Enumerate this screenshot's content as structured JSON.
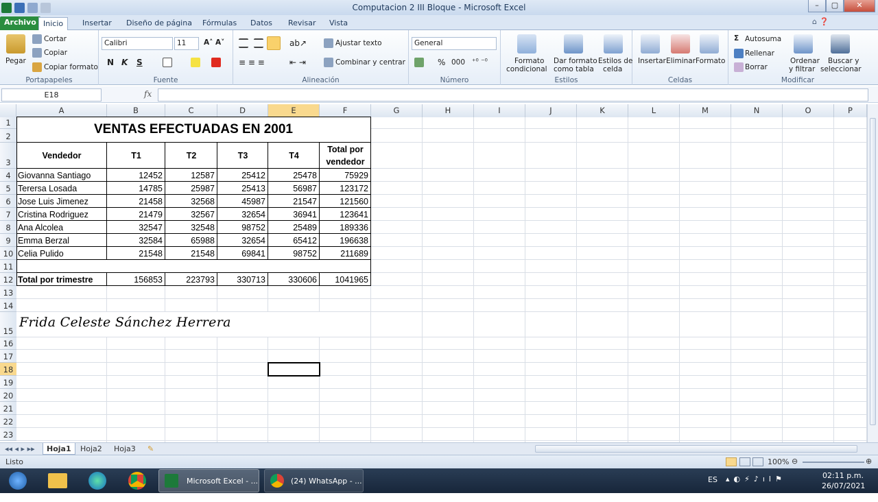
{
  "window": {
    "title": "Computacion 2 III Bloque  -  Microsoft Excel"
  },
  "tabs": [
    "Archivo",
    "Inicio",
    "Insertar",
    "Diseño de página",
    "Fórmulas",
    "Datos",
    "Revisar",
    "Vista"
  ],
  "ribbon": {
    "portapapeles": {
      "pegar": "Pegar",
      "cortar": "Cortar",
      "copiar": "Copiar",
      "copiar_formato": "Copiar formato",
      "name": "Portapapeles"
    },
    "fuente": {
      "font": "Calibri",
      "size": "11",
      "name": "Fuente",
      "bold": "N",
      "italic": "K",
      "underline": "S"
    },
    "alineacion": {
      "ajustar": "Ajustar texto",
      "combinar": "Combinar y centrar",
      "name": "Alineación"
    },
    "numero": {
      "format": "General",
      "name": "Número",
      "percent": "%",
      "thousands": "000"
    },
    "estilos": {
      "formato_cond_1": "Formato",
      "formato_cond_2": "condicional",
      "dar_formato_1": "Dar formato",
      "dar_formato_2": "como tabla",
      "estilos_celda_1": "Estilos de",
      "estilos_celda_2": "celda",
      "name": "Estilos"
    },
    "celdas": {
      "insertar": "Insertar",
      "eliminar": "Eliminar",
      "formato": "Formato",
      "name": "Celdas"
    },
    "modificar": {
      "autosuma": "Autosuma",
      "rellenar": "Rellenar",
      "borrar": "Borrar",
      "ordenar_1": "Ordenar",
      "ordenar_2": "y filtrar",
      "buscar_1": "Buscar y",
      "buscar_2": "seleccionar",
      "name": "Modificar"
    }
  },
  "formula_bar": {
    "namebox": "E18",
    "fx": "fx",
    "value": ""
  },
  "columns": [
    "A",
    "B",
    "C",
    "D",
    "E",
    "F",
    "G",
    "H",
    "I",
    "J",
    "K",
    "L",
    "M",
    "N",
    "O",
    "P"
  ],
  "rows": [
    "1",
    "2",
    "3",
    "4",
    "5",
    "6",
    "7",
    "8",
    "9",
    "10",
    "11",
    "12",
    "13",
    "14",
    "15",
    "16",
    "17",
    "18",
    "19",
    "20",
    "21",
    "22",
    "23"
  ],
  "sheet": {
    "title": "VENTAS EFECTUADAS EN 2001",
    "headers": [
      "Vendedor",
      "T1",
      "T2",
      "T3",
      "T4",
      "Total por",
      "vendedor"
    ],
    "data": [
      [
        "Giovanna Santiago",
        "12452",
        "12587",
        "25412",
        "25478",
        "75929"
      ],
      [
        "Terersa Losada",
        "14785",
        "25987",
        "25413",
        "56987",
        "123172"
      ],
      [
        "Jose Luis Jimenez",
        "21458",
        "32568",
        "45987",
        "21547",
        "121560"
      ],
      [
        "Cristina Rodriguez",
        "21479",
        "32567",
        "32654",
        "36941",
        "123641"
      ],
      [
        "Ana Alcolea",
        "32547",
        "32548",
        "98752",
        "25489",
        "189336"
      ],
      [
        "Emma Berzal",
        "32584",
        "65988",
        "32654",
        "65412",
        "196638"
      ],
      [
        "Celia Pulido",
        "21548",
        "21548",
        "69841",
        "98752",
        "211689"
      ]
    ],
    "totals": [
      "Total por trimestre",
      "156853",
      "223793",
      "330713",
      "330606",
      "1041965"
    ],
    "signature": "Frida Celeste Sánchez Herrera"
  },
  "sheet_tabs": [
    "Hoja1",
    "Hoja2",
    "Hoja3"
  ],
  "status": {
    "left": "Listo",
    "zoom": "100%"
  },
  "taskbar": {
    "excel": "Microsoft Excel - ...",
    "whatsapp": "(24) WhatsApp - ...",
    "lang": "ES",
    "time": "02:11 p.m.",
    "date": "26/07/2021"
  }
}
